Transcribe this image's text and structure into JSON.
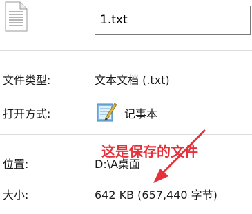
{
  "file_name": "1.txt",
  "rows": {
    "type_label": "文件类型:",
    "type_value": "文本文档 (.txt)",
    "opens_with_label": "打开方式:",
    "opens_with_value": "记事本",
    "location_label": "位置:",
    "location_value": "D:\\A桌面",
    "size_label": "大小:",
    "size_value": "642 KB (657,440 字节)"
  },
  "annotation": {
    "text": "这是保存的文件",
    "color": "#e8303a"
  },
  "icons": {
    "file": "text-file-icon",
    "notepad": "notepad-icon"
  }
}
